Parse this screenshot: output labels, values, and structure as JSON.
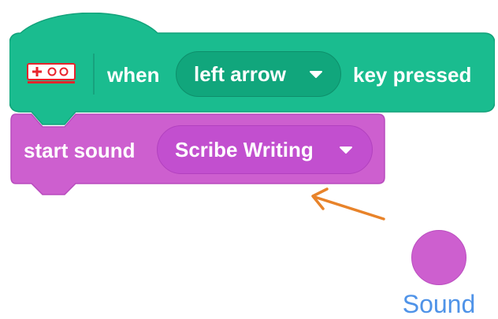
{
  "hat_block": {
    "when_label": "when",
    "key_dropdown_value": "left arrow",
    "pressed_label": "key pressed",
    "extension_icon": "makey-makey-icon",
    "colors": {
      "fill": "#1abc8f",
      "dropdown": "#11a67c",
      "icon_red": "#e8232b"
    }
  },
  "sound_block": {
    "label": "start sound",
    "sound_dropdown_value": "Scribe Writing",
    "colors": {
      "fill": "#cd5fcf",
      "dropdown": "#c24fcf"
    }
  },
  "annotation": {
    "icon": "orange-arrow-icon",
    "color": "#e8832a"
  },
  "category": {
    "label": "Sound",
    "dot_color": "#cd5fcf",
    "label_color": "#4f93e8"
  }
}
